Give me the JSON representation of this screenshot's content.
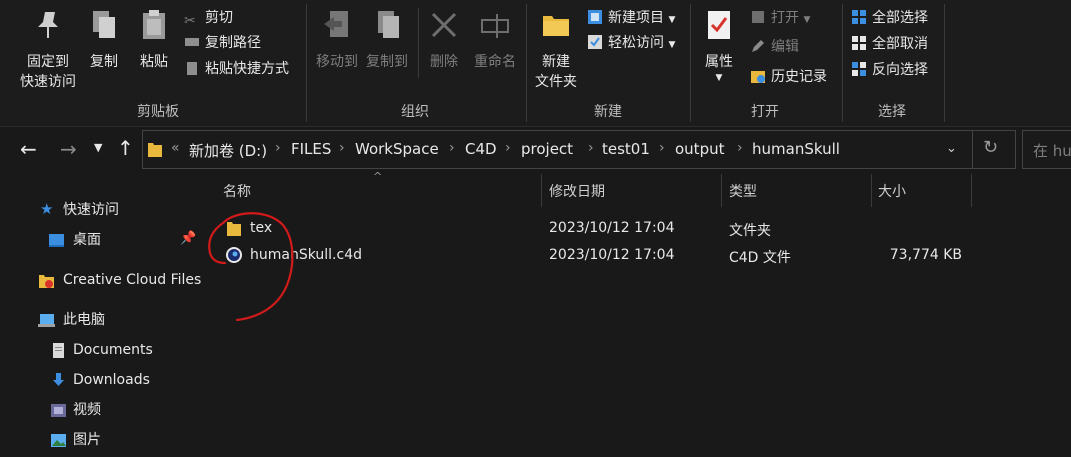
{
  "ribbon": {
    "clipboard": {
      "pin_label_1": "固定到",
      "pin_label_2": "快速访问",
      "copy": "复制",
      "paste": "粘贴",
      "cut": "剪切",
      "copy_path": "复制路径",
      "paste_shortcut": "粘贴快捷方式",
      "group_label": "剪贴板"
    },
    "organize": {
      "move_to": "移动到",
      "copy_to": "复制到",
      "delete": "删除",
      "rename": "重命名",
      "group_label": "组织"
    },
    "new": {
      "new_folder_1": "新建",
      "new_folder_2": "文件夹",
      "new_item": "新建项目",
      "easy_access": "轻松访问",
      "group_label": "新建"
    },
    "open": {
      "properties": "属性",
      "open": "打开",
      "edit": "编辑",
      "history": "历史记录",
      "group_label": "打开"
    },
    "select": {
      "select_all": "全部选择",
      "select_none": "全部取消",
      "invert": "反向选择",
      "group_label": "选择"
    }
  },
  "address": {
    "overflow": "«",
    "crumbs": [
      "新加卷 (D:)",
      "FILES",
      "WorkSpace",
      "C4D",
      "project",
      "test01",
      "output",
      "humanSkull"
    ],
    "search_placeholder": "在 hu"
  },
  "nav": {
    "quick_access": "快速访问",
    "desktop": "桌面",
    "creative_cloud": "Creative Cloud Files",
    "this_pc": "此电脑",
    "documents": "Documents",
    "downloads": "Downloads",
    "videos": "视频",
    "pictures": "图片"
  },
  "columns": {
    "name": "名称",
    "modified": "修改日期",
    "type": "类型",
    "size": "大小"
  },
  "files": [
    {
      "name": "tex",
      "modified": "2023/10/12 17:04",
      "type": "文件夹",
      "size": ""
    },
    {
      "name": "humanSkull.c4d",
      "modified": "2023/10/12 17:04",
      "type": "C4D 文件",
      "size": "73,774 KB"
    }
  ],
  "colors": {
    "folder": "#e8b93d",
    "accent_blue": "#3b8ee0",
    "annotation": "#d11a1a"
  }
}
